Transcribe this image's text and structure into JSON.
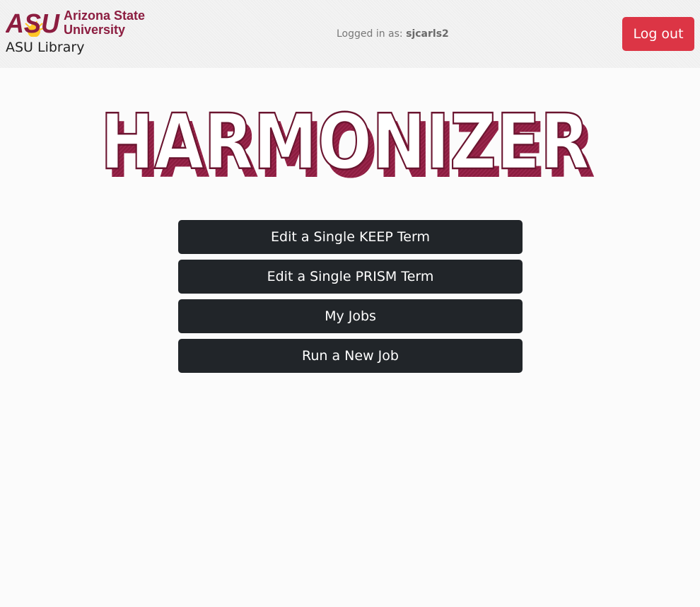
{
  "header": {
    "logo": {
      "lettermark": "ASU",
      "name_line1": "Arizona State",
      "name_line2": "University",
      "brand_color": "#8c1d40",
      "sun_color": "#ffc627"
    },
    "library_label": "ASU Library",
    "login_prefix": "Logged in as:",
    "username": "sjcarls2",
    "logout_label": "Log out",
    "logout_color": "#dc3545"
  },
  "main": {
    "title": "HARMONIZER",
    "title_shadow_color": "#8c1d40",
    "buttons": [
      {
        "label": "Edit a Single KEEP Term"
      },
      {
        "label": "Edit a Single PRISM Term"
      },
      {
        "label": "My Jobs"
      },
      {
        "label": "Run a New Job"
      }
    ],
    "button_color": "#212529"
  }
}
